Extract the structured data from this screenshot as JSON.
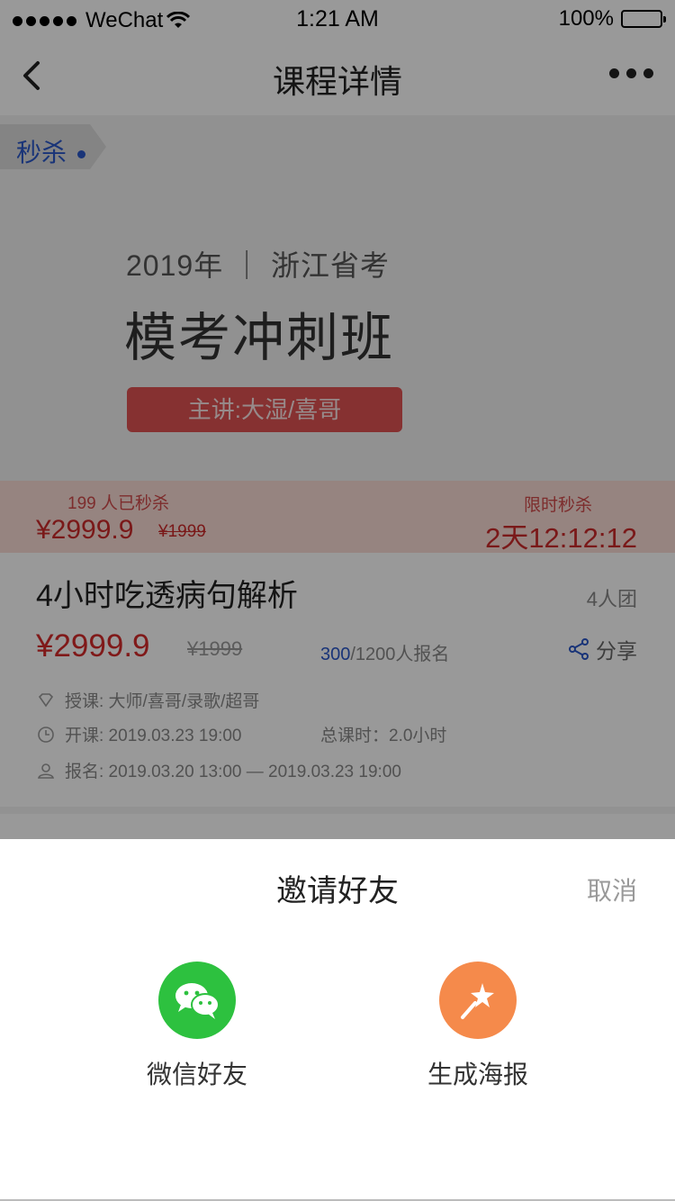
{
  "status_bar": {
    "carrier": "WeChat",
    "time": "1:21 AM",
    "battery": "100%"
  },
  "navbar": {
    "title": "课程详情",
    "back_icon": "chevron-left-icon",
    "more_icon": "more-dots-icon"
  },
  "banner": {
    "tag": "秒杀",
    "year_line": "2019年 ｜ 浙江省考",
    "course_banner_title": "模考冲刺班",
    "teacher_label": "主讲:大湿/喜哥"
  },
  "flash_sale": {
    "sold_count": "199 人已秒杀",
    "price": "¥2999.9",
    "original_price": "¥1999",
    "label": "限时秒杀",
    "countdown": "2天12:12:12"
  },
  "course": {
    "title": "4小时吃透病句解析",
    "group": "4人团",
    "price": "¥2999.9",
    "original_price": "¥1999",
    "enroll_count": "300",
    "enroll_total": "/1200人报名",
    "share_label": "分享",
    "teachers": "授课: 大师/喜哥/录歌/超哥",
    "start": "开课: 2019.03.23   19:00",
    "hours": "总课时：2.0小时",
    "signup": "报名: 2019.03.20   13:00 — 2019.03.23   19:00"
  },
  "sheet": {
    "title": "邀请好友",
    "cancel": "取消",
    "options": [
      {
        "label": "微信好友",
        "icon": "wechat-icon",
        "color": "#2dc13f"
      },
      {
        "label": "生成海报",
        "icon": "magic-wand-icon",
        "color": "#f58a4b"
      }
    ]
  },
  "colors": {
    "accent_red": "#d52b2b",
    "link_blue": "#2b58c9"
  }
}
